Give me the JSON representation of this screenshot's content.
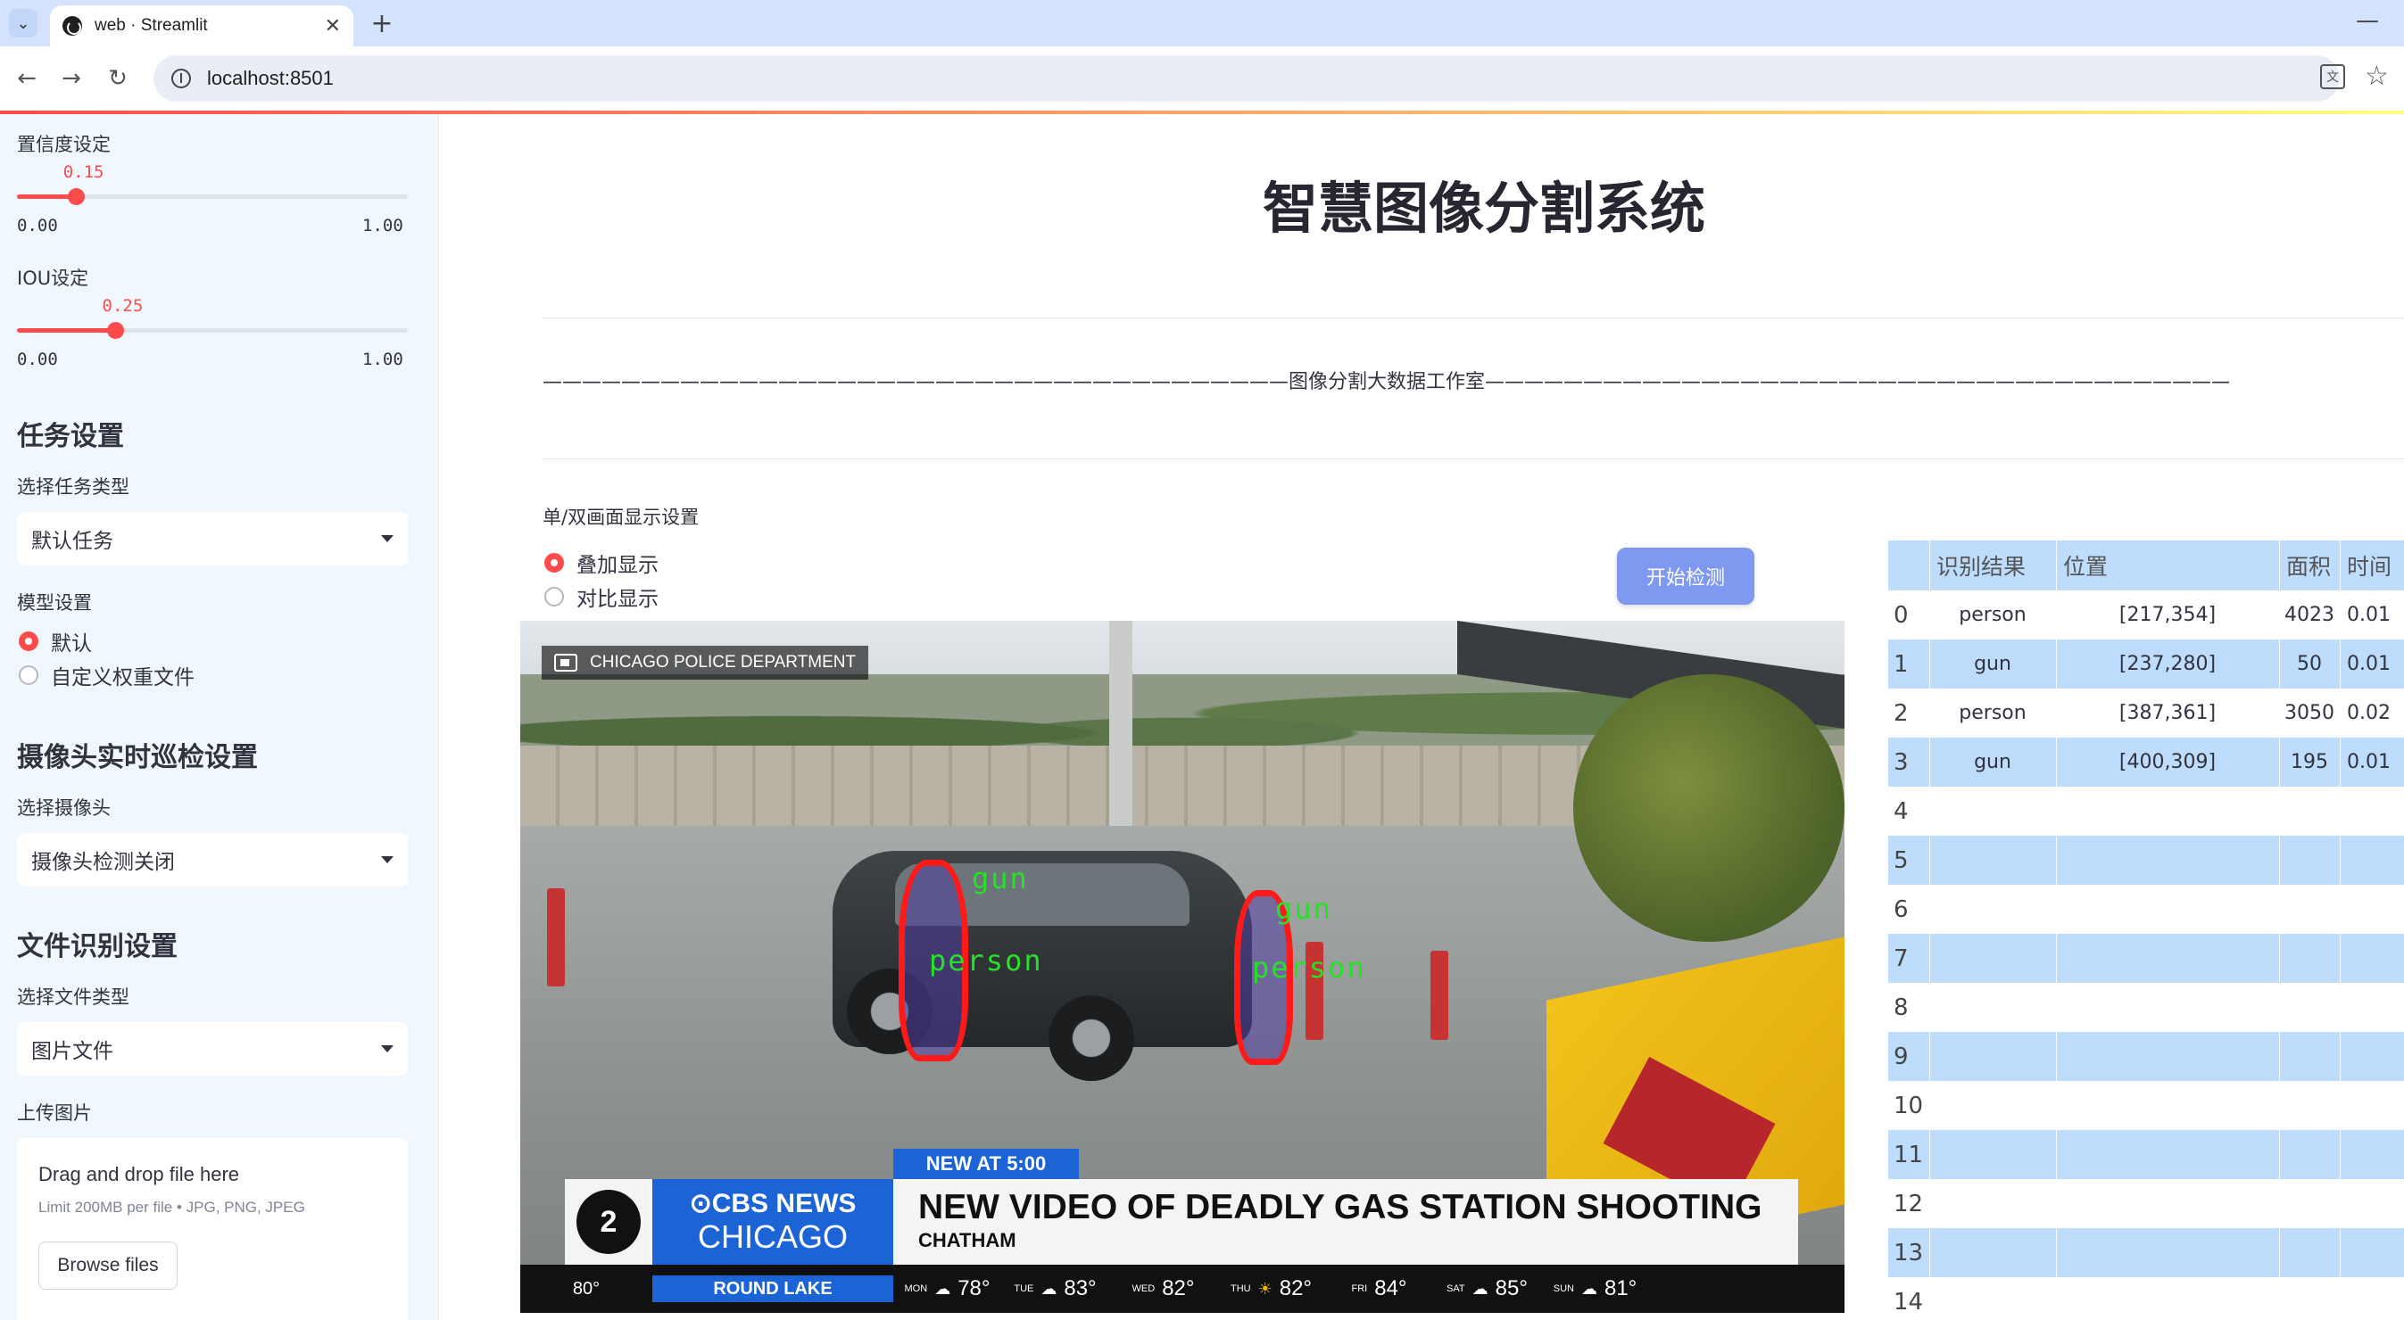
{
  "browser": {
    "tab_title": "web · Streamlit",
    "url": "localhost:8501",
    "icons": [
      "chevron-down-icon",
      "close-icon",
      "plus-icon",
      "minimize-icon",
      "back-icon",
      "forward-icon",
      "reload-icon",
      "site-info-icon",
      "translate-icon",
      "star-icon"
    ]
  },
  "sidebar": {
    "confidence": {
      "label": "置信度设定",
      "value": "0.15",
      "min": "0.00",
      "max": "1.00",
      "fraction": 0.15
    },
    "iou": {
      "label": "IOU设定",
      "value": "0.25",
      "min": "0.00",
      "max": "1.00",
      "fraction": 0.25
    },
    "task_header": "任务设置",
    "task_type_label": "选择任务类型",
    "task_type_value": "默认任务",
    "model_label": "模型设置",
    "model_options": [
      "默认",
      "自定义权重文件"
    ],
    "model_selected": 0,
    "camera_header": "摄像头实时巡检设置",
    "camera_label": "选择摄像头",
    "camera_value": "摄像头检测关闭",
    "file_header": "文件识别设置",
    "file_type_label": "选择文件类型",
    "file_type_value": "图片文件",
    "upload_label": "上传图片",
    "upload_title": "Drag and drop file here",
    "upload_limit": "Limit 200MB per file • JPG, PNG, JPEG",
    "browse_label": "Browse files"
  },
  "main": {
    "title": "智慧图像分割系统",
    "studio_line": "——————————————————————————————————————图像分割大数据工作室——————————————————————————————————————",
    "display_label": "单/双画面显示设置",
    "display_options": [
      "叠加显示",
      "对比显示"
    ],
    "display_selected": 0,
    "start_button": "开始检测"
  },
  "video": {
    "camera_tag": "CHICAGO POLICE DEPARTMENT",
    "detections": [
      {
        "label": "gun"
      },
      {
        "label": "person"
      },
      {
        "label": "gun"
      },
      {
        "label": "person"
      }
    ],
    "news": {
      "flag": "NEW AT 5:00",
      "logo": "2",
      "brand_line1": "⊙CBS NEWS",
      "brand_line2": "CHICAGO",
      "headline": "NEW VIDEO OF DEADLY GAS STATION SHOOTING",
      "subhead": "CHATHAM",
      "ticker_temp": "80°",
      "ticker_place": "ROUND LAKE",
      "forecast": [
        {
          "day": "MON",
          "temp": "78°",
          "icon": "cloud-icon"
        },
        {
          "day": "TUE",
          "temp": "83°",
          "icon": "cloud-icon"
        },
        {
          "day": "WED",
          "temp": "82°",
          "icon": "none"
        },
        {
          "day": "THU",
          "temp": "82°",
          "icon": "sun-icon"
        },
        {
          "day": "FRI",
          "temp": "84°",
          "icon": "none"
        },
        {
          "day": "SAT",
          "temp": "85°",
          "icon": "cloud-icon"
        },
        {
          "day": "SUN",
          "temp": "81°",
          "icon": "cloud-icon"
        }
      ]
    }
  },
  "results_table": {
    "headers": [
      "识别结果",
      "位置",
      "面积",
      "时间"
    ],
    "rows": [
      {
        "index": "0",
        "label": "person",
        "position": "[217,354]",
        "area": "4023",
        "time": "0.01"
      },
      {
        "index": "1",
        "label": "gun",
        "position": "[237,280]",
        "area": "50",
        "time": "0.01"
      },
      {
        "index": "2",
        "label": "person",
        "position": "[387,361]",
        "area": "3050",
        "time": "0.02"
      },
      {
        "index": "3",
        "label": "gun",
        "position": "[400,309]",
        "area": "195",
        "time": "0.01"
      },
      {
        "index": "4"
      },
      {
        "index": "5"
      },
      {
        "index": "6"
      },
      {
        "index": "7"
      },
      {
        "index": "8"
      },
      {
        "index": "9"
      },
      {
        "index": "10"
      },
      {
        "index": "11"
      },
      {
        "index": "12"
      },
      {
        "index": "13"
      },
      {
        "index": "14"
      }
    ]
  },
  "colors": {
    "accent": "#ff4b4b",
    "sidebar_bg": "#f0f8fe",
    "table_stripe": "#bedcfc",
    "button": "#7f98f0",
    "mask_outline": "#ff1a1a",
    "label_green": "#29e029"
  }
}
